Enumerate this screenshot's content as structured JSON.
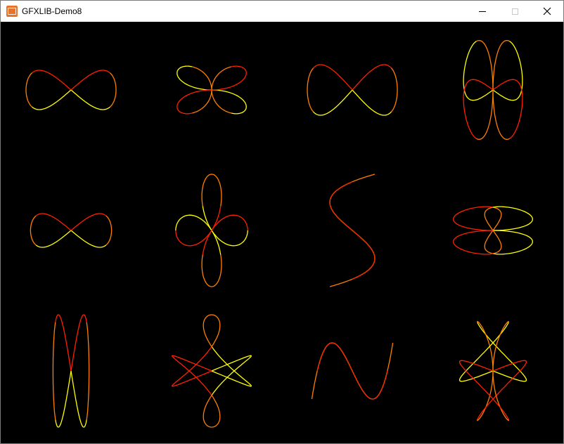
{
  "window": {
    "title": "GFXLIB-Demo8",
    "icon": "gfxlib-app-icon",
    "controls": {
      "minimize": "minimize-icon",
      "maximize": "maximize-icon",
      "close": "close-icon"
    }
  },
  "canvas": {
    "background": "#000000",
    "rows": 3,
    "columns": 4,
    "curve_colors": [
      "#ffff00",
      "#ff8000",
      "#ff2000"
    ]
  }
}
